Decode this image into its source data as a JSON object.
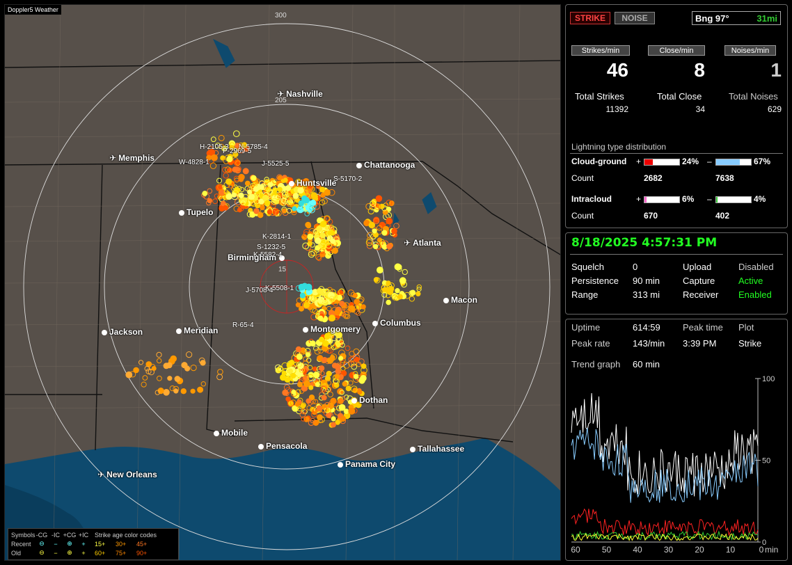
{
  "map": {
    "title": "Doppler5 Weather",
    "rings": [
      "300",
      "205",
      "15"
    ],
    "cities": [
      {
        "name": "Nashville",
        "type": "airport"
      },
      {
        "name": "Memphis",
        "type": "airport"
      },
      {
        "name": "Chattanooga",
        "type": "city"
      },
      {
        "name": "Huntsville",
        "type": "city"
      },
      {
        "name": "Tupelo",
        "type": "city"
      },
      {
        "name": "Atlanta",
        "type": "airport"
      },
      {
        "name": "Birmingham",
        "type": "city"
      },
      {
        "name": "Macon",
        "type": "city"
      },
      {
        "name": "Jackson",
        "type": "city"
      },
      {
        "name": "Meridian",
        "type": "city"
      },
      {
        "name": "Montgomery",
        "type": "city"
      },
      {
        "name": "Columbus",
        "type": "city"
      },
      {
        "name": "Dothan",
        "type": "city"
      },
      {
        "name": "Mobile",
        "type": "city"
      },
      {
        "name": "Pensacola",
        "type": "city"
      },
      {
        "name": "Tallahassee",
        "type": "city"
      },
      {
        "name": "Panama City",
        "type": "city"
      },
      {
        "name": "New Orleans",
        "type": "airport"
      }
    ],
    "tracks": [
      "H-2105-3",
      "N-5785-4",
      "P-2969-5",
      "W-4828-1",
      "J-5525-5",
      "S-5170-2",
      "K-2814-1",
      "S-1232-5",
      "K-5582-4",
      "J-5708-4",
      "K-5508-1",
      "R-65-4"
    ],
    "legend": {
      "header": [
        "Symbols",
        "-CG",
        "-IC",
        "+CG",
        "+IC",
        "Strike age color codes"
      ],
      "recent_label": "Recent",
      "old_label": "Old",
      "recent_ages": [
        "15+",
        "30+",
        "45+"
      ],
      "old_ages": [
        "60+",
        "75+",
        "90+"
      ],
      "age_colors": [
        "#ffff44",
        "#ff9900",
        "#ff7722",
        "#ffcc00",
        "#ff8800",
        "#ff5500"
      ]
    }
  },
  "status": {
    "strike_btn": "STRIKE",
    "noise_btn": "NOISE",
    "bearing": "Bng 97°",
    "distance": "31mi",
    "strikes_per_min_label": "Strikes/min",
    "close_per_min_label": "Close/min",
    "noises_per_min_label": "Noises/min",
    "strikes_per_min": "46",
    "close_per_min": "8",
    "noises_per_min": "1",
    "total_strikes_label": "Total Strikes",
    "total_close_label": "Total Close",
    "total_noises_label": "Total Noises",
    "total_strikes": "11392",
    "total_close": "34",
    "total_noises": "629",
    "distribution_title": "Lightning type distribution",
    "cg_label": "Cloud-ground",
    "ic_label": "Intracloud",
    "count_label": "Count",
    "plus": "+",
    "minus": "–",
    "cg_pos_pct": "24%",
    "cg_neg_pct": "67%",
    "cg_pos_count": "2682",
    "cg_neg_count": "7638",
    "ic_pos_pct": "6%",
    "ic_neg_pct": "4%",
    "ic_pos_count": "670",
    "ic_neg_count": "402",
    "bar_levels": {
      "cg_pos": 0.24,
      "cg_neg": 0.67,
      "ic_pos": 0.06,
      "ic_neg": 0.04
    },
    "bar_colors": {
      "cg_pos": "#ee0000",
      "cg_neg": "#88ccff",
      "ic_pos": "#ff66cc",
      "ic_neg": "#33cc33"
    }
  },
  "settings": {
    "datetime": "8/18/2025 4:57:31 PM",
    "squelch_label": "Squelch",
    "squelch": "0",
    "persistence_label": "Persistence",
    "persistence": "90 min",
    "range_label": "Range",
    "range": "313 mi",
    "upload_label": "Upload",
    "upload": "Disabled",
    "capture_label": "Capture",
    "capture": "Active",
    "receiver_label": "Receiver",
    "receiver": "Enabled"
  },
  "trend": {
    "uptime_label": "Uptime",
    "uptime": "614:59",
    "peak_time_label": "Peak time",
    "plot_label": "Plot",
    "peak_rate_label": "Peak rate",
    "peak_rate": "143/min",
    "peak_time": "3:39 PM",
    "plot": "Strike",
    "trend_graph_label": "Trend graph",
    "trend_graph": "60 min",
    "y_ticks": [
      "100",
      "50",
      "0"
    ],
    "x_ticks": [
      "60",
      "50",
      "40",
      "30",
      "20",
      "10",
      "0"
    ],
    "x_unit": "min"
  }
}
